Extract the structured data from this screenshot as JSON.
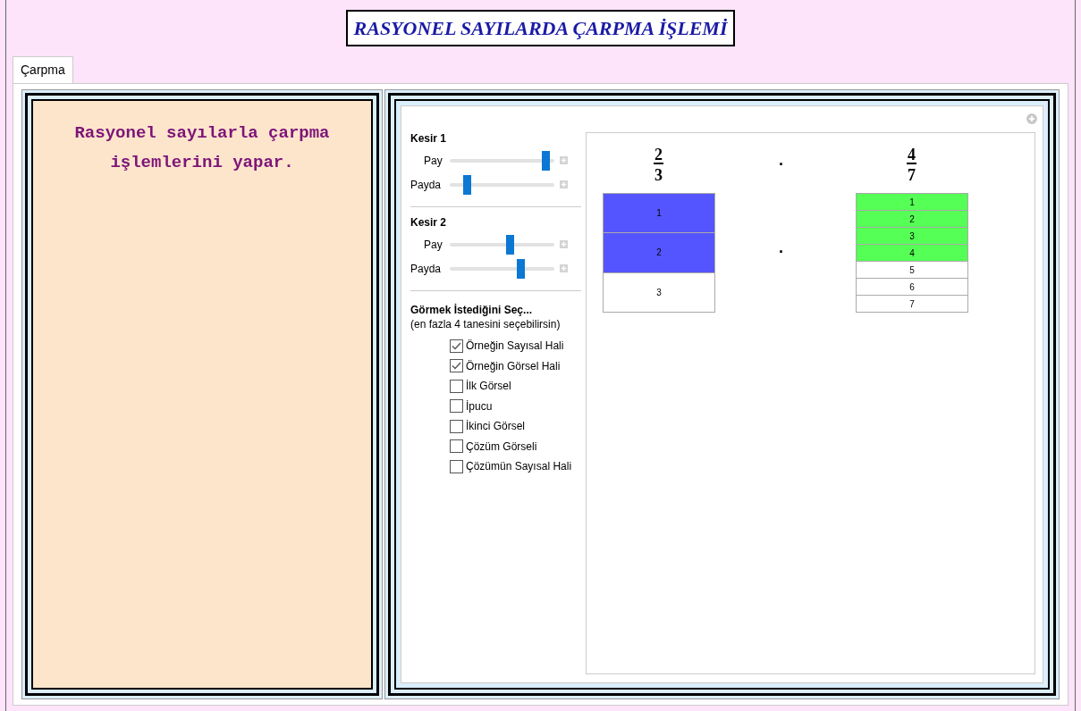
{
  "title": "RASYONEL SAYILARDA ÇARPMA İŞLEMİ",
  "tabs": [
    {
      "label": "Çarpma",
      "selected": true
    }
  ],
  "description": "Rasyonel sayılarla çarpma işlemlerini yapar.",
  "controls": {
    "groups": [
      {
        "title": "Kesir 1",
        "sliders": [
          {
            "label": "Pay",
            "level": 0.95
          },
          {
            "label": "Payda",
            "level": 0.14
          }
        ]
      },
      {
        "title": "Kesir 2",
        "sliders": [
          {
            "label": "Pay",
            "level": 0.58
          },
          {
            "label": "Payda",
            "level": 0.69
          }
        ]
      }
    ],
    "choice_title": "Görmek İstediğini Seç...",
    "choice_hint": "(en fazla 4 tanesini seçebilirsin)",
    "options": [
      {
        "label": "Örneğin Sayısal Hali",
        "checked": true
      },
      {
        "label": "Örneğin Görsel Hali",
        "checked": true
      },
      {
        "label": "İlk Görsel",
        "checked": false
      },
      {
        "label": "İpucu",
        "checked": false
      },
      {
        "label": "İkinci Görsel",
        "checked": false
      },
      {
        "label": "Çözüm Görseli",
        "checked": false
      },
      {
        "label": "Çözümün Sayısal Hali",
        "checked": false
      }
    ]
  },
  "display": {
    "fractions": [
      {
        "numerator": "2",
        "denominator": "3"
      },
      {
        "numerator": "4",
        "denominator": "7"
      }
    ],
    "operators": [
      "·",
      "·"
    ],
    "bars": [
      {
        "color": "#5555ff",
        "cells": [
          {
            "label": "1",
            "filled": true
          },
          {
            "label": "2",
            "filled": true
          },
          {
            "label": "3",
            "filled": false
          }
        ]
      },
      {
        "color": "#55ff55",
        "cells": [
          {
            "label": "1",
            "filled": true
          },
          {
            "label": "2",
            "filled": true
          },
          {
            "label": "3",
            "filled": true
          },
          {
            "label": "4",
            "filled": true
          },
          {
            "label": "5",
            "filled": false
          },
          {
            "label": "6",
            "filled": false
          },
          {
            "label": "7",
            "filled": false
          }
        ]
      }
    ]
  }
}
